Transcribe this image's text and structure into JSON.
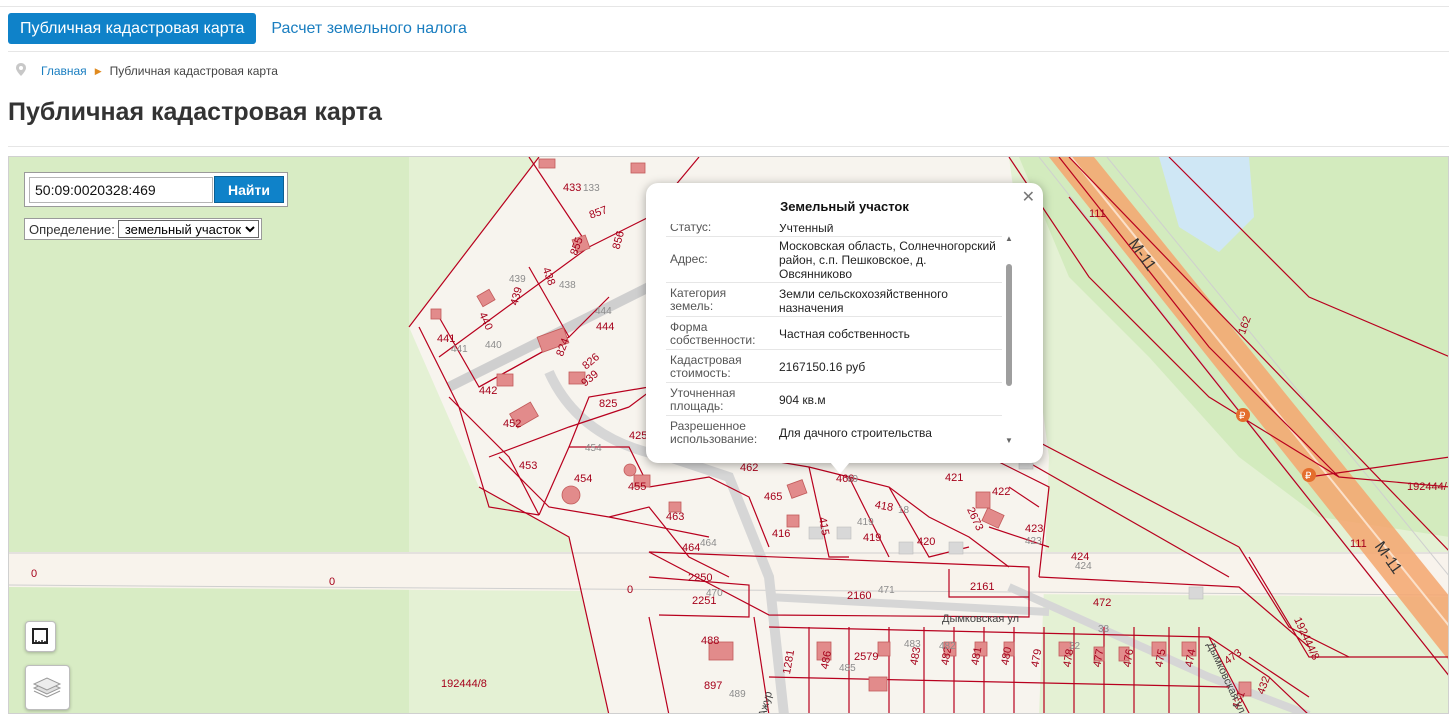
{
  "nav": {
    "tabs": [
      {
        "label": "Публичная кадастровая карта",
        "active": true
      },
      {
        "label": "Расчет земельного налога",
        "active": false
      }
    ]
  },
  "breadcrumb": {
    "home": "Главная",
    "current": "Публичная кадастровая карта",
    "icon": "map-pin-icon"
  },
  "page": {
    "title": "Публичная кадастровая карта"
  },
  "search": {
    "value": "50:09:0020328:469",
    "button": "Найти"
  },
  "definition": {
    "label": "Определение:",
    "selected": "земельный участок"
  },
  "popup": {
    "title": "Земельный участок",
    "rows": [
      {
        "label": "Статус:",
        "value": "Учтенный"
      },
      {
        "label": "Адрес:",
        "value": "Московская область, Солнечногорский район, с.п. Пешковское, д. Овсянниково"
      },
      {
        "label": "Категория земель:",
        "value": "Земли сельскохозяйственного назначения"
      },
      {
        "label": "Форма собственности:",
        "value": "Частная собственность"
      },
      {
        "label": "Кадастровая стоимость:",
        "value": "2167150.16 руб"
      },
      {
        "label": "Уточненная площадь:",
        "value": "904 кв.м"
      },
      {
        "label": "Разрешенное использование:",
        "value": "Для дачного строительства"
      }
    ]
  },
  "map": {
    "parcel_labels": [
      "433",
      "857",
      "856",
      "855",
      "438",
      "439",
      "440",
      "441",
      "442",
      "452",
      "453",
      "454",
      "455",
      "463",
      "464",
      "824",
      "826",
      "939",
      "825",
      "444",
      "425",
      "462",
      "465",
      "415",
      "416",
      "419",
      "418",
      "420",
      "421",
      "422",
      "2673",
      "423",
      "424",
      "2250",
      "2251",
      "2160",
      "2161",
      "472",
      "488",
      "897",
      "1281",
      "486",
      "2579",
      "483",
      "482",
      "481",
      "480",
      "479",
      "478",
      "477",
      "476",
      "475",
      "474",
      "473",
      "431",
      "432",
      "469",
      "111",
      "162",
      "192444/8",
      "0",
      "470",
      "471",
      "489",
      "485"
    ],
    "grey_numbers": [
      "133",
      "441",
      "440",
      "439",
      "438",
      "444",
      "454",
      "464",
      "18",
      "419",
      "423",
      "424",
      "470",
      "471",
      "489",
      "485",
      "33",
      "32",
      "483",
      "482",
      "469"
    ],
    "road_labels": [
      "М-11",
      "Дымковская ул",
      "Дымковская ул",
      "Ажур"
    ]
  },
  "colors": {
    "accent": "#0f82c9",
    "parcel_line": "#b8001e",
    "parcel_label": "#a5001a",
    "highway": "#f4a66e",
    "greenery": "#d6eec1"
  }
}
